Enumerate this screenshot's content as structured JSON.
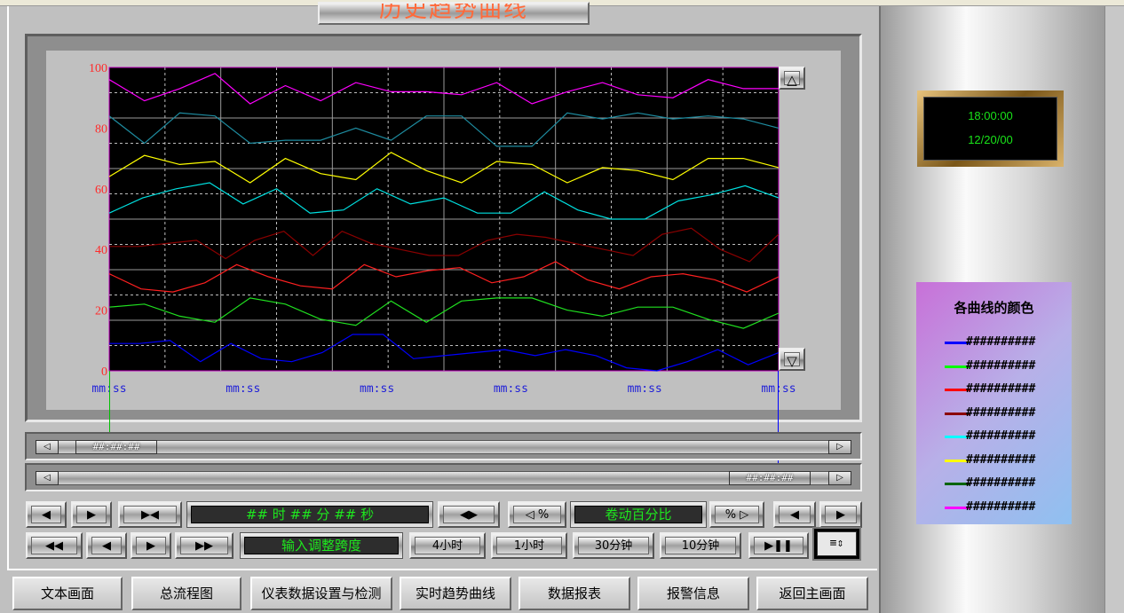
{
  "title": "历史趋势曲线",
  "clock": {
    "time": "18:00:00",
    "date": "12/20/00"
  },
  "legend": {
    "title": "各曲线的颜色",
    "items": [
      {
        "color": "#0000ff",
        "text": "##########"
      },
      {
        "color": "#00ff00",
        "text": "##########"
      },
      {
        "color": "#ff0000",
        "text": "##########"
      },
      {
        "color": "#8b0000",
        "text": "##########"
      },
      {
        "color": "#00ffff",
        "text": "##########"
      },
      {
        "color": "#ffff00",
        "text": "##########"
      },
      {
        "color": "#006400",
        "text": "##########"
      },
      {
        "color": "#ff00ff",
        "text": "##########"
      }
    ]
  },
  "chart_data": {
    "type": "line",
    "ylim": [
      0,
      100
    ],
    "yticks": [
      "100",
      "80",
      "60",
      "40",
      "20",
      "0"
    ],
    "xticks": [
      "mm:ss",
      "mm:ss",
      "mm:ss",
      "mm:ss",
      "mm:ss",
      "mm:ss"
    ],
    "grid": true,
    "series": [
      {
        "color": "#ff00ff",
        "values": [
          96,
          89,
          93,
          98,
          88,
          94,
          89,
          95,
          92,
          92,
          91,
          95,
          88,
          92,
          95,
          91,
          90,
          96,
          93,
          93
        ]
      },
      {
        "color": "#1e8ca0",
        "values": [
          84,
          75,
          85,
          84,
          75,
          76,
          76,
          80,
          76,
          84,
          84,
          74,
          74,
          85,
          83,
          85,
          83,
          84,
          83,
          80
        ]
      },
      {
        "color": "#ffff00",
        "values": [
          64,
          71,
          68,
          69,
          62,
          70,
          65,
          63,
          72,
          66,
          62,
          69,
          68,
          62,
          67,
          66,
          63,
          70,
          70,
          67
        ]
      },
      {
        "color": "#00e0e0",
        "values": [
          52,
          57,
          60,
          62,
          55,
          60,
          52,
          53,
          60,
          55,
          57,
          52,
          52,
          59,
          53,
          50,
          50,
          56,
          58,
          61,
          57
        ]
      },
      {
        "color": "#8b0000",
        "values": [
          41,
          41,
          42,
          43,
          37,
          43,
          46,
          38,
          46,
          42,
          40,
          38,
          38,
          43,
          45,
          44,
          42,
          40,
          38,
          45,
          47,
          40,
          36,
          45
        ]
      },
      {
        "color": "#ff2020",
        "values": [
          32,
          27,
          26,
          29,
          35,
          31,
          28,
          27,
          35,
          31,
          33,
          34,
          29,
          31,
          36,
          30,
          27,
          31,
          32,
          30,
          26,
          31
        ]
      },
      {
        "color": "#20e020",
        "values": [
          21,
          22,
          18,
          16,
          24,
          22,
          17,
          15,
          23,
          16,
          23,
          24,
          24,
          20,
          18,
          21,
          21,
          17,
          14,
          19
        ]
      },
      {
        "color": "#0000ff",
        "values": [
          9,
          9,
          10,
          3,
          9,
          4,
          3,
          6,
          12,
          12,
          4,
          5,
          6,
          7,
          5,
          7,
          5,
          1,
          0,
          3,
          7,
          2,
          6
        ]
      }
    ]
  },
  "scroll_top": {
    "thumb": "##:##:##",
    "left_btn": "◁",
    "right_btn": "▷"
  },
  "scroll_bottom": {
    "thumb": "##:##:##",
    "left_btn": "◁",
    "right_btn": "▷"
  },
  "up_btn": "△",
  "down_btn": "▽",
  "controls": {
    "time_display": "## 时 ## 分 ## 秒",
    "scroll_pct_label": "卷动百分比",
    "input_span_label": "输入调整跨度",
    "pct_left": "◁ %",
    "pct_right": "% ▷",
    "span_4h": "4小时",
    "span_1h": "1小时",
    "span_30m": "30分钟",
    "span_10m": "10分钟"
  },
  "nav": [
    "文本画面",
    "总流程图",
    "仪表数据设置与检测",
    "实时趋势曲线",
    "数据报表",
    "报警信息",
    "返回主画面"
  ]
}
